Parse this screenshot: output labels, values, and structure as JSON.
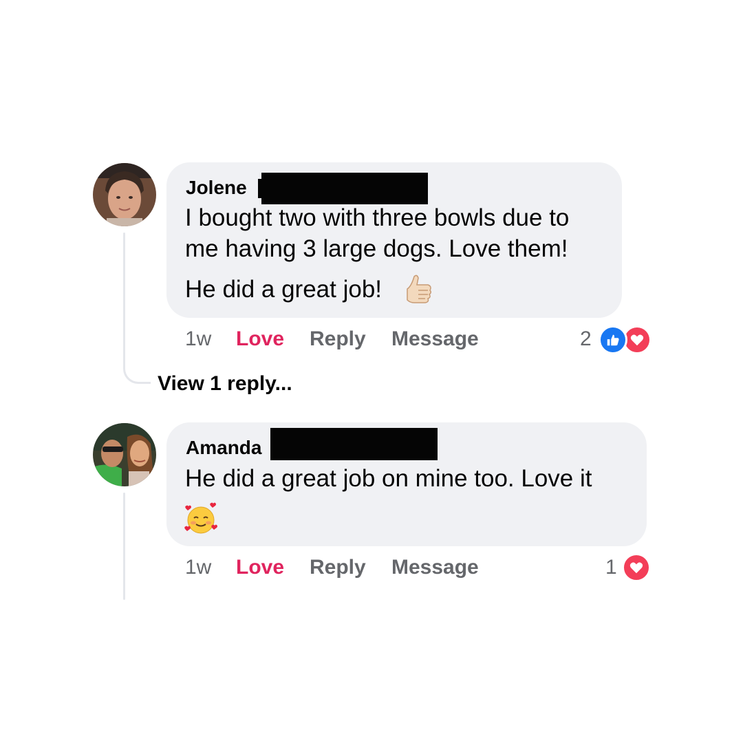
{
  "comments": [
    {
      "author": "Jolene",
      "author_name_redacted": true,
      "lines": [
        "I bought two with three bowls due to",
        "me having 3 large dogs. Love them!",
        "He did a great job!"
      ],
      "trailing_emoji": "thumbs-up",
      "actions": {
        "time": "1w",
        "love": "Love",
        "reply": "Reply",
        "message": "Message"
      },
      "reaction_count": "2",
      "reactions": [
        "like",
        "heart"
      ],
      "view_replies": "View 1 reply..."
    },
    {
      "author": "Amanda",
      "author_name_redacted": true,
      "lines": [
        "He did a great job on mine too.  Love it"
      ],
      "trailing_emoji": "smiling-face-with-hearts",
      "actions": {
        "time": "1w",
        "love": "Love",
        "reply": "Reply",
        "message": "Message"
      },
      "reaction_count": "1",
      "reactions": [
        "heart"
      ]
    }
  ],
  "colors": {
    "bubble": "#f0f1f4",
    "love_accent": "#e0245e",
    "secondary_text": "#65676b",
    "like_blue": "#1877f2",
    "heart_red": "#f33e58"
  }
}
